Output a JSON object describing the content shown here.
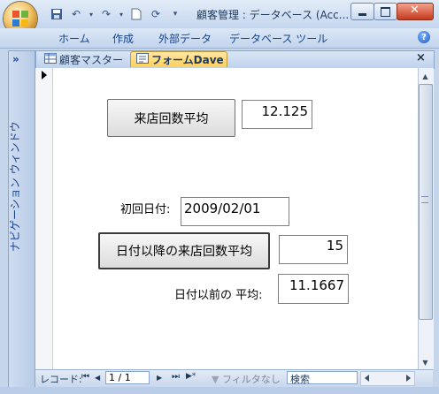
{
  "window": {
    "title": "顧客管理 : データベース (Acc..."
  },
  "quick_access": {
    "icons": [
      "save-icon",
      "undo-icon",
      "redo-icon",
      "new-document-icon",
      "refresh-icon",
      "customize-dropdown-icon"
    ]
  },
  "ribbon": {
    "tabs": [
      "ホーム",
      "作成",
      "外部データ",
      "データベース ツール"
    ],
    "help": "?"
  },
  "nav_pane": {
    "toggle": "»",
    "label": "ナビゲーション ウィンドウ"
  },
  "doc_tabs": {
    "tabs": [
      {
        "label": "顧客マスター",
        "icon": "table-icon",
        "active": false
      },
      {
        "label": "フォームDave",
        "icon": "form-icon",
        "active": true
      }
    ],
    "close": "×"
  },
  "form": {
    "avg_button": "来店回数平均",
    "avg_value": "12.125",
    "first_date_label": "初回日付:",
    "first_date_value": "2009/02/01",
    "after_button": "日付以降の来店回数平均",
    "after_value": "15",
    "before_label": "日付以前の 平均:",
    "before_value": "11.1667"
  },
  "record_nav": {
    "label": "レコード:",
    "first": "⏮",
    "prev": "◀",
    "counter": "1 / 1",
    "next": "▶",
    "last": "⏭",
    "new": "▶*",
    "filter": "フィルタなし",
    "search": "検索"
  },
  "colors": {
    "accent": "#ffcf5a",
    "chrome": "#c5d5ea",
    "close": "#c43a1e"
  }
}
